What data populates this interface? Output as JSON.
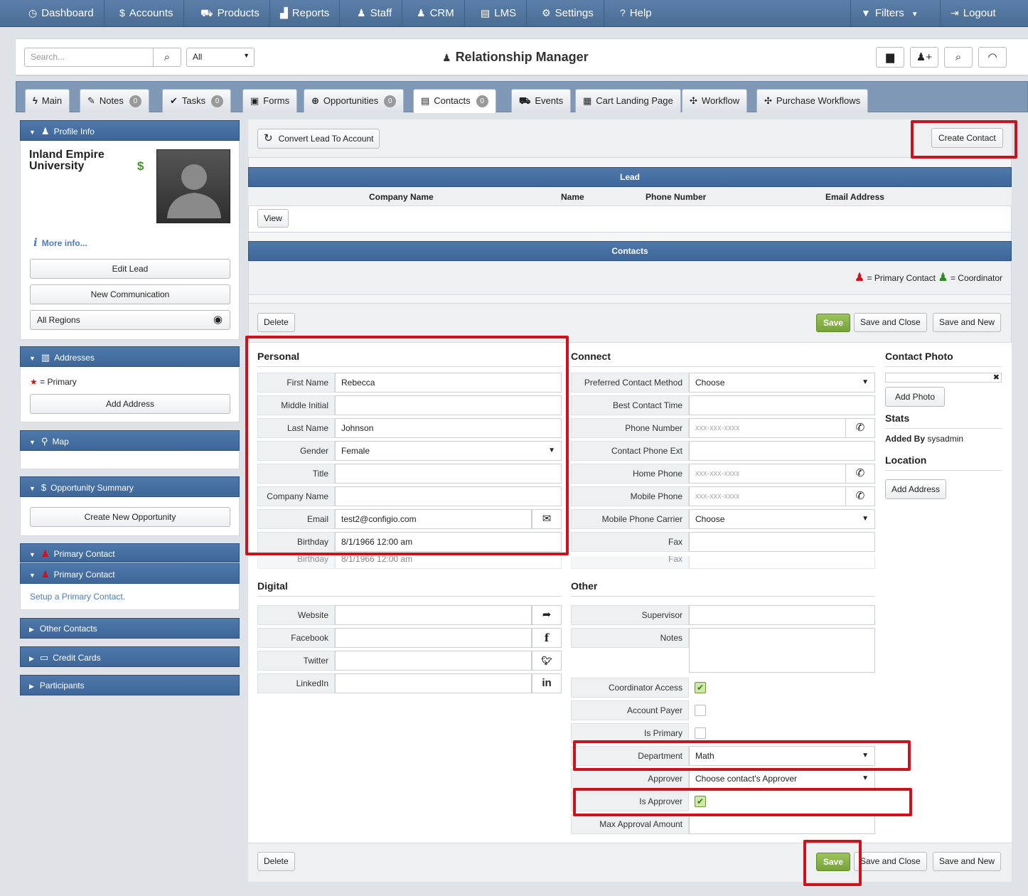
{
  "topnav": {
    "items": [
      {
        "label": "Dashboard",
        "icon": "dashboard-icon"
      },
      {
        "label": "Accounts",
        "icon": "dollar-icon"
      },
      {
        "label": "Products",
        "icon": "cart-icon"
      },
      {
        "label": "Reports",
        "icon": "chart-icon"
      },
      {
        "label": "Staff",
        "icon": "user-icon"
      },
      {
        "label": "CRM",
        "icon": "users-icon"
      },
      {
        "label": "LMS",
        "icon": "book-icon"
      },
      {
        "label": "Settings",
        "icon": "gear-icon"
      },
      {
        "label": "Help",
        "icon": "question-icon"
      }
    ],
    "filters": "Filters",
    "logout": "Logout"
  },
  "header": {
    "search_placeholder": "Search...",
    "scope": "All",
    "title": "Relationship Manager"
  },
  "tabs": [
    {
      "label": "Main",
      "badge": null
    },
    {
      "label": "Notes",
      "badge": "0"
    },
    {
      "label": "Tasks",
      "badge": "0"
    },
    {
      "label": "Forms",
      "badge": null
    },
    {
      "label": "Opportunities",
      "badge": "0"
    },
    {
      "label": "Contacts",
      "badge": "0"
    },
    {
      "label": "Events",
      "badge": null
    },
    {
      "label": "Cart Landing Page",
      "badge": null
    },
    {
      "label": "Workflow",
      "badge": null
    },
    {
      "label": "Purchase Workflows",
      "badge": null
    }
  ],
  "sidebar": {
    "profile": {
      "title": "Profile Info",
      "name": "Inland Empire University",
      "more_info": "More info...",
      "edit_lead": "Edit Lead",
      "new_communication": "New Communication",
      "regions": "All Regions"
    },
    "addresses": {
      "title": "Addresses",
      "primary_legend": "= Primary",
      "add_address": "Add Address"
    },
    "map": {
      "title": "Map"
    },
    "opportunity": {
      "title": "Opportunity Summary",
      "create": "Create New Opportunity"
    },
    "primary_contact": {
      "title": "Primary Contact",
      "title2": "Primary Contact",
      "setup_link": "Setup a Primary Contact."
    },
    "other_contacts": "Other Contacts",
    "credit_cards": "Credit Cards",
    "participants": "Participants"
  },
  "toolbar": {
    "convert": "Convert Lead To Account",
    "create_contact": "Create Contact"
  },
  "lead_panel": {
    "title": "Lead",
    "columns": [
      "Company Name",
      "Name",
      "Phone Number",
      "Email Address"
    ],
    "view": "View"
  },
  "contacts_panel": {
    "title": "Contacts",
    "legend_primary": "= Primary Contact",
    "legend_coordinator": "= Coordinator"
  },
  "form": {
    "delete": "Delete",
    "save": "Save",
    "save_close": "Save and Close",
    "save_new": "Save and New",
    "personal": {
      "heading": "Personal",
      "fields": [
        {
          "label": "First Name",
          "value": "Rebecca"
        },
        {
          "label": "Middle Initial",
          "value": ""
        },
        {
          "label": "Last Name",
          "value": "Johnson"
        },
        {
          "label": "Gender",
          "value": "Female"
        },
        {
          "label": "Title",
          "value": ""
        },
        {
          "label": "Company Name",
          "value": ""
        },
        {
          "label": "Email",
          "value": "test2@configio.com"
        },
        {
          "label": "Birthday",
          "value": "8/1/1966 12:00 am"
        }
      ],
      "ghost_label": "Birthday",
      "ghost_value": "8/1/1966 12:00 am"
    },
    "connect": {
      "heading": "Connect",
      "fields": [
        {
          "label": "Preferred Contact Method",
          "value": "Choose"
        },
        {
          "label": "Best Contact Time",
          "value": ""
        },
        {
          "label": "Phone Number",
          "value": "xxx-xxx-xxxx"
        },
        {
          "label": "Contact Phone Ext",
          "value": ""
        },
        {
          "label": "Home Phone",
          "value": "xxx-xxx-xxxx"
        },
        {
          "label": "Mobile Phone",
          "value": "xxx-xxx-xxxx"
        },
        {
          "label": "Mobile Phone Carrier",
          "value": "Choose"
        },
        {
          "label": "Fax",
          "value": ""
        }
      ],
      "ghost_label": "Fax"
    },
    "digital": {
      "heading": "Digital",
      "fields": [
        {
          "label": "Website",
          "value": ""
        },
        {
          "label": "Facebook",
          "value": ""
        },
        {
          "label": "Twitter",
          "value": ""
        },
        {
          "label": "LinkedIn",
          "value": ""
        }
      ]
    },
    "other": {
      "heading": "Other",
      "supervisor": "Supervisor",
      "notes": "Notes",
      "coordinator_access": "Coordinator Access",
      "account_payer": "Account Payer",
      "is_primary": "Is Primary",
      "department": "Department",
      "department_value": "Math",
      "approver": "Approver",
      "approver_value": "Choose contact's Approver",
      "is_approver": "Is Approver",
      "max_approval": "Max Approval Amount"
    },
    "photo": {
      "heading": "Contact Photo",
      "add_photo": "Add Photo",
      "stats_heading": "Stats",
      "added_by_label": "Added By",
      "added_by_value": "sysadmin",
      "location_heading": "Location",
      "add_address": "Add Address"
    }
  },
  "colors": {
    "accent": "#4f79ab",
    "highlight": "#d0101a",
    "save": "#86b046"
  }
}
